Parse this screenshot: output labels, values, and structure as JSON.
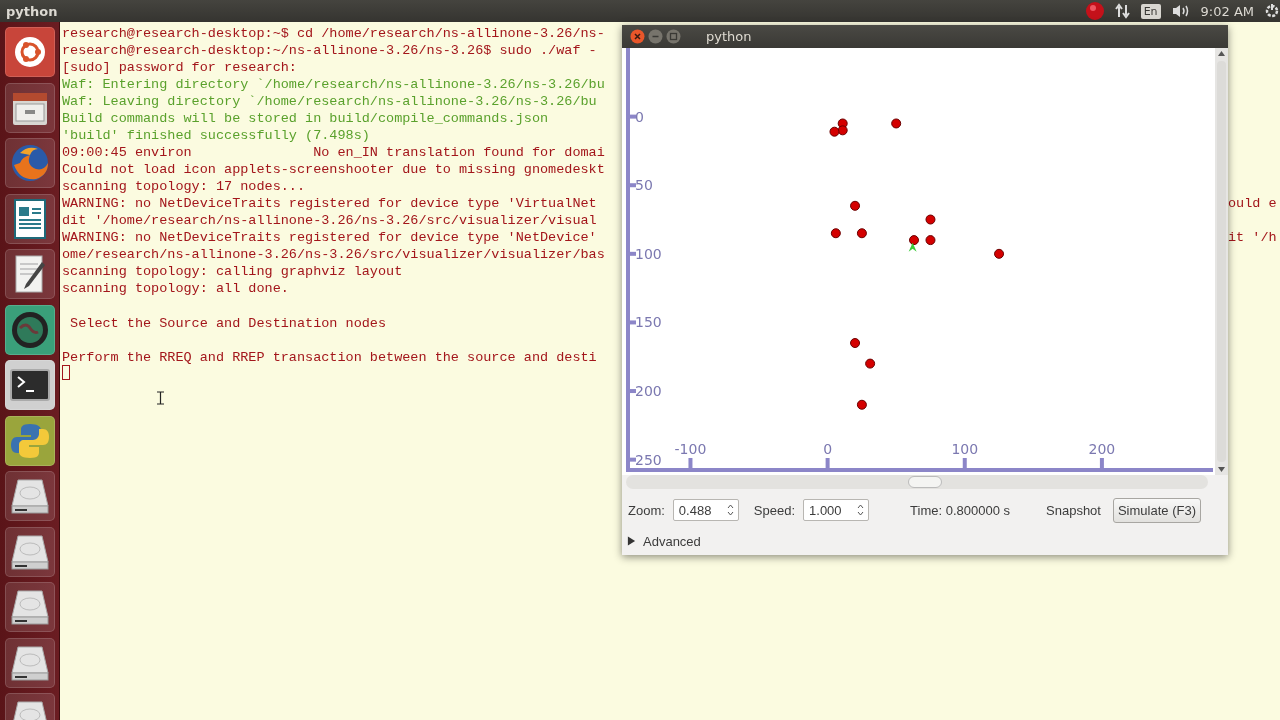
{
  "top_bar": {
    "title": "python",
    "keyboard": "En",
    "clock": "9:02 AM"
  },
  "launcher": {
    "items": [
      {
        "kind": "ubuntu"
      },
      {
        "kind": "files"
      },
      {
        "kind": "browser"
      },
      {
        "kind": "document"
      },
      {
        "kind": "editor"
      },
      {
        "kind": "globe"
      },
      {
        "kind": "terminal"
      },
      {
        "kind": "python"
      },
      {
        "kind": "drive"
      },
      {
        "kind": "drive"
      },
      {
        "kind": "drive"
      },
      {
        "kind": "drive"
      },
      {
        "kind": "drive"
      }
    ]
  },
  "terminal": {
    "lines": [
      {
        "text": "research@research-desktop:~$ cd /home/research/ns-allinone-3.26/ns-",
        "color": "#a3161b",
        "blank_before": false
      },
      {
        "text": "research@research-desktop:~/ns-allinone-3.26/ns-3.26$ sudo ./waf -",
        "color": "#a3161b",
        "blank_before": false
      },
      {
        "text": "[sudo] password for research:",
        "color": "#a3161b",
        "blank_before": false
      },
      {
        "text": "Waf: Entering directory `/home/research/ns-allinone-3.26/ns-3.26/bu",
        "color": "#5aa12c",
        "blank_before": false
      },
      {
        "text": "Waf: Leaving directory `/home/research/ns-allinone-3.26/ns-3.26/bu",
        "color": "#5aa12c",
        "blank_before": false
      },
      {
        "text": "Build commands will be stored in build/compile_commands.json",
        "color": "#5aa12c",
        "blank_before": false
      },
      {
        "text": "'build' finished successfully (7.498s)",
        "color": "#5aa12c",
        "blank_before": false
      },
      {
        "text": "09:00:45 environ               No en_IN translation found for domai",
        "color": "#a3161b",
        "blank_before": false
      },
      {
        "text": "Could not load icon applets-screenshooter due to missing gnomedeskt",
        "color": "#a3161b",
        "blank_before": false
      },
      {
        "text": "scanning topology: 17 nodes...",
        "color": "#a3161b",
        "blank_before": false
      },
      {
        "text": "WARNING: no NetDeviceTraits registered for device type 'VirtualNet",
        "tail": "ould e",
        "color": "#a3161b",
        "blank_before": false
      },
      {
        "text": "dit '/home/research/ns-allinone-3.26/ns-3.26/src/visualizer/visual",
        "color": "#a3161b",
        "blank_before": false
      },
      {
        "text": "WARNING: no NetDeviceTraits registered for device type 'NetDevice'",
        "tail": "it '/h",
        "color": "#a3161b",
        "blank_before": false
      },
      {
        "text": "ome/research/ns-allinone-3.26/ns-3.26/src/visualizer/visualizer/bas",
        "color": "#a3161b",
        "blank_before": false
      },
      {
        "text": "scanning topology: calling graphviz layout",
        "color": "#a3161b",
        "blank_before": false
      },
      {
        "text": "scanning topology: all done.",
        "color": "#a3161b",
        "blank_before": false
      },
      {
        "text": " Select the Source and Destination nodes",
        "color": "#a3161b",
        "blank_before": true
      },
      {
        "text": "Perform the RREQ and RREP transaction between the source and desti",
        "color": "#a3161b",
        "blank_before": true
      }
    ],
    "cursor": true
  },
  "window": {
    "title": "python",
    "chart_data": {
      "type": "scatter",
      "x": [
        11,
        11,
        5,
        50,
        20,
        75,
        6,
        25,
        63,
        75,
        125,
        20,
        31,
        25
      ],
      "values": [
        5,
        10,
        11,
        5,
        65,
        75,
        85,
        85,
        90,
        90,
        100,
        165,
        180,
        210
      ],
      "xticks": [
        -100,
        0,
        100,
        200
      ],
      "yticks": [
        0,
        50,
        100,
        150,
        200,
        250
      ],
      "xlim": [
        -147,
        281
      ],
      "ylim": [
        259,
        -50
      ]
    },
    "controls": {
      "zoom_label": "Zoom:",
      "zoom": "0.488",
      "speed_label": "Speed:",
      "speed": "1.000",
      "time": "Time: 0.800000 s",
      "snapshot": "Snapshot",
      "simulate": "Simulate (F3)"
    },
    "advanced": {
      "label": "Advanced",
      "expanded": false
    }
  }
}
